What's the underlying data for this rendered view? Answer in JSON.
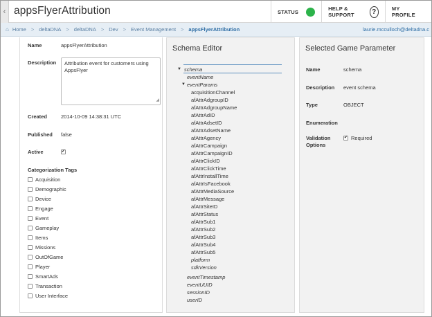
{
  "header": {
    "title": "appsFlyerAttribution",
    "status_label": "STATUS",
    "status_color": "#2cb34a",
    "help_label": "HELP & SUPPORT",
    "help_icon": "?",
    "profile_label": "MY PROFILE"
  },
  "breadcrumb": {
    "items": [
      "Home",
      "deltaDNA",
      "deltaDNA",
      "Dev",
      "Event Management"
    ],
    "current": "appsFlyerAttribution",
    "user": "laurie.mcculloch@deltadna.c"
  },
  "event": {
    "name_label": "Name",
    "name_value": "appsFlyerAttribution",
    "description_label": "Description",
    "description_value": "Attribution event for customers using AppsFlyer",
    "created_label": "Created",
    "created_value": "2014-10-09 14:38:31 UTC",
    "published_label": "Published",
    "published_value": "false",
    "active_label": "Active",
    "active_checked": "✔",
    "tags_label": "Categorization Tags",
    "tags": [
      "Acquisition",
      "Demographic",
      "Device",
      "Engage",
      "Event",
      "Gameplay",
      "Items",
      "Missions",
      "OutOfGame",
      "Player",
      "SmartAds",
      "Transaction",
      "User Interface"
    ]
  },
  "schema_editor": {
    "title": "Schema Editor",
    "root": "schema",
    "root_children": [
      "eventName"
    ],
    "event_params": "eventParams",
    "params": [
      "acquisitionChannel",
      "afAttrAdgroupID",
      "afAttrAdgroupName",
      "afAttrAdID",
      "afAttrAdsetID",
      "afAttrAdsetName",
      "afAttrAgency",
      "afAttrCampaign",
      "afAttrCampaignID",
      "afAttrClickID",
      "afAttrClickTime",
      "afAttrInstallTime",
      "afAttrIsFacebook",
      "afAttrMediaSource",
      "afAttrMessage",
      "afAttrSiteID",
      "afAttrStatus",
      "afAttrSub1",
      "afAttrSub2",
      "afAttrSub3",
      "afAttrSub4",
      "afAttrSub5"
    ],
    "italic_params": [
      "platform",
      "sdkVersion"
    ],
    "trailing": [
      "eventTimestamp",
      "eventUUID",
      "sessionID",
      "userID"
    ]
  },
  "selected_param": {
    "title": "Selected Game Parameter",
    "name_label": "Name",
    "name_value": "schema",
    "description_label": "Description",
    "description_value": "event schema",
    "type_label": "Type",
    "type_value": "OBJECT",
    "enumeration_label": "Enumeration",
    "validation_label_1": "Validation",
    "validation_label_2": "Options",
    "required_label": "Required",
    "required_checked": "✔"
  }
}
